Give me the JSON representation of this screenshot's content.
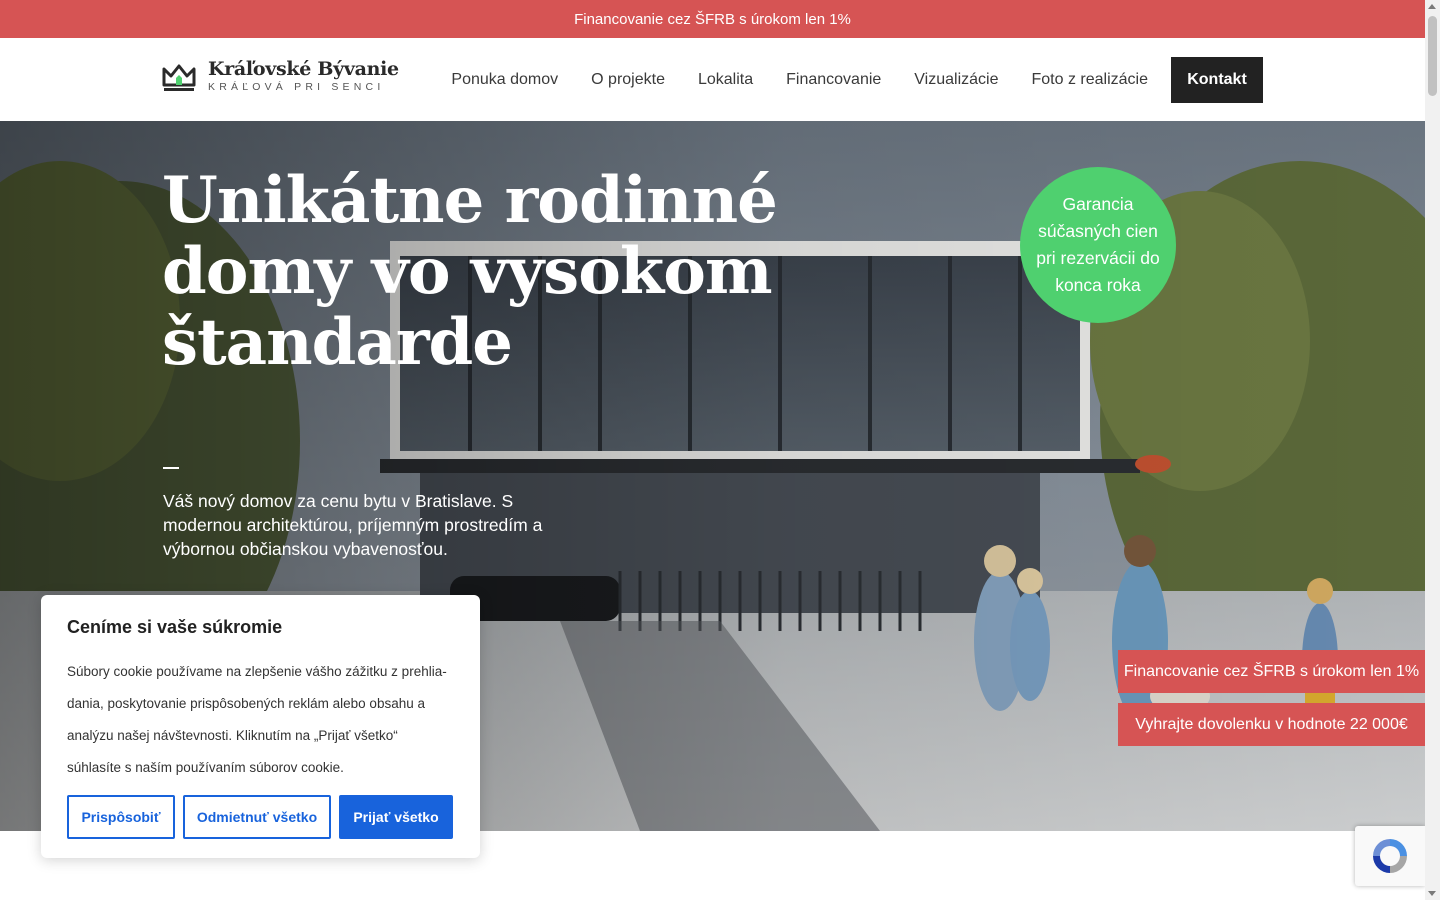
{
  "topbar": {
    "text": "Financovanie cez ŠFRB s úrokom len 1%"
  },
  "logo": {
    "name": "Kráľovské Bývanie",
    "subtitle": "KRÁĽOVÁ PRI SENCI",
    "icon": "crown-house-icon"
  },
  "nav": {
    "items": [
      {
        "label": "Ponuka domov"
      },
      {
        "label": "O projekte"
      },
      {
        "label": "Lokalita"
      },
      {
        "label": "Financovanie"
      },
      {
        "label": "Vizualizácie"
      },
      {
        "label": "Foto z realizácie"
      }
    ],
    "cta": "Kontakt"
  },
  "hero": {
    "title": "Unikátne rodinné domy vo vysokom štandarde",
    "description": "Váš nový domov za cenu bytu v Bratislave. S moder­nou architektúrou, príjemným prostredím a výbor­nou občianskou vybavenosťou.",
    "badge": "Garancia súčasných cien pri rezervácii do konca roka",
    "badge_color": "#4fd06f"
  },
  "promos": [
    {
      "label": "Financovanie cez ŠFRB s úrokom len 1%"
    },
    {
      "label": "Vyhrajte dovolenku v hodnote 22 000€"
    }
  ],
  "cookie": {
    "title": "Ceníme si vaše súkromie",
    "text": "Súbory cookie používame na zlepšenie vášho zážitku z prehlia­dania, poskytovanie prispôsobených reklám alebo obsahu a analýzu našej návštevnosti. Kliknutím na „Prijať všetko“ súhlasíte s naším používaním súborov cookie.",
    "buttons": {
      "customize": "Prispôsobiť",
      "reject": "Odmietnuť všetko",
      "accept": "Prijať všetko"
    }
  },
  "colors": {
    "accent_red": "#d65454",
    "accent_green": "#4fd06f",
    "cookie_blue": "#1863dc",
    "dark": "#222222"
  }
}
